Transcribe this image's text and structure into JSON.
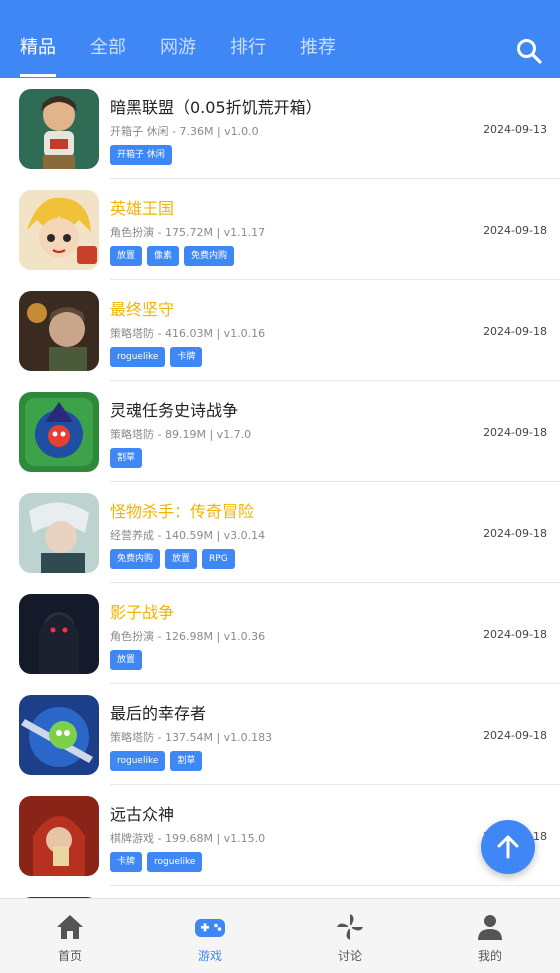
{
  "header": {
    "tabs": [
      {
        "label": "精品",
        "active": true
      },
      {
        "label": "全部"
      },
      {
        "label": "网游"
      },
      {
        "label": "排行"
      },
      {
        "label": "推荐"
      }
    ],
    "search_icon": "search-icon"
  },
  "games": [
    {
      "title": "暗黑联盟（0.05折饥荒开箱）",
      "meta": "开箱子 休闲 - 7.36M | v1.0.0",
      "date": "2024-09-13",
      "tags": [
        "开箱子 休闲"
      ],
      "highlight": false
    },
    {
      "title": "英雄王国",
      "meta": "角色扮演 - 175.72M | v1.1.17",
      "date": "2024-09-18",
      "tags": [
        "放置",
        "像素",
        "免费内购"
      ],
      "highlight": true
    },
    {
      "title": "最终坚守",
      "meta": "策略塔防 - 416.03M | v1.0.16",
      "date": "2024-09-18",
      "tags": [
        "roguelike",
        "卡牌"
      ],
      "highlight": true
    },
    {
      "title": "灵魂任务史诗战争",
      "meta": "策略塔防 - 89.19M | v1.7.0",
      "date": "2024-09-18",
      "tags": [
        "割草"
      ],
      "highlight": false
    },
    {
      "title": "怪物杀手：传奇冒险",
      "meta": "经营养成 - 140.59M | v3.0.14",
      "date": "2024-09-18",
      "tags": [
        "免费内购",
        "放置",
        "RPG"
      ],
      "highlight": true
    },
    {
      "title": "影子战争",
      "meta": "角色扮演 - 126.98M | v1.0.36",
      "date": "2024-09-18",
      "tags": [
        "放置"
      ],
      "highlight": true
    },
    {
      "title": "最后的幸存者",
      "meta": "策略塔防 - 137.54M | v1.0.183",
      "date": "2024-09-18",
      "tags": [
        "roguelike",
        "割草"
      ],
      "highlight": false
    },
    {
      "title": "远古众神",
      "meta": "棋牌游戏 - 199.68M | v1.15.0",
      "date": "2024-09-18",
      "tags": [
        "卡牌",
        "roguelike"
      ],
      "highlight": false
    }
  ],
  "bottom_nav": [
    {
      "label": "首页",
      "icon": "home-icon"
    },
    {
      "label": "游戏",
      "icon": "gamepad-icon",
      "active": true
    },
    {
      "label": "讨论",
      "icon": "pinwheel-icon"
    },
    {
      "label": "我的",
      "icon": "user-icon"
    }
  ],
  "colors": {
    "primary": "#3f87f5",
    "highlight_title": "#f2b400"
  }
}
